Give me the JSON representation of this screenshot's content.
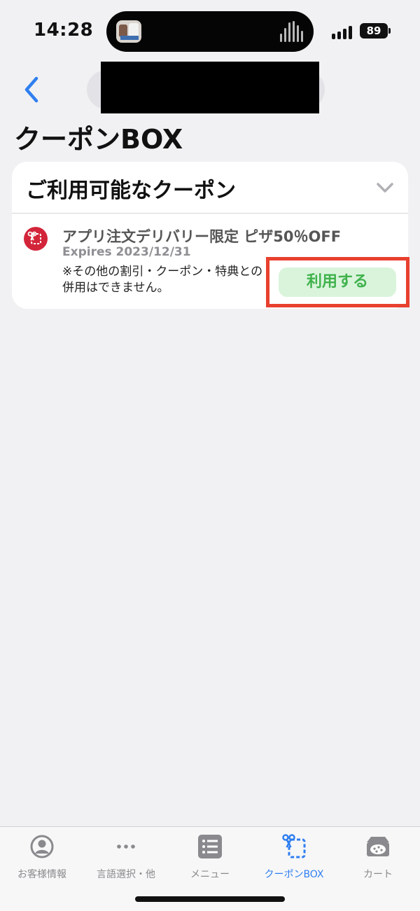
{
  "status_bar": {
    "time": "14:28",
    "battery": "89"
  },
  "page": {
    "title": "クーポンBOX"
  },
  "coupon_section": {
    "title": "ご利用可能なクーポン",
    "coupons": [
      {
        "title": "アプリ注文デリバリー限定 ピザ50％OFF",
        "expires": "Expires 2023/12/31",
        "note": "※その他の割引・クーポン・特典との併用はできません。",
        "use_label": "利用する",
        "icon": "scissors-coupon-icon"
      }
    ]
  },
  "tab_bar": {
    "tabs": [
      {
        "label": "お客様情報",
        "icon": "user-circle-icon",
        "active": false
      },
      {
        "label": "言語選択・他",
        "icon": "more-dots-icon",
        "active": false
      },
      {
        "label": "メニュー",
        "icon": "menu-list-icon",
        "active": false
      },
      {
        "label": "クーポンBOX",
        "icon": "coupon-scissors-icon",
        "active": true
      },
      {
        "label": "カート",
        "icon": "pizza-box-icon",
        "active": false
      }
    ]
  },
  "colors": {
    "accent": "#2f7ff0",
    "use_button_text": "#3fb24c",
    "use_button_bg": "#daf4dc",
    "highlight": "#e8402e",
    "coupon_icon": "#d3253a"
  }
}
